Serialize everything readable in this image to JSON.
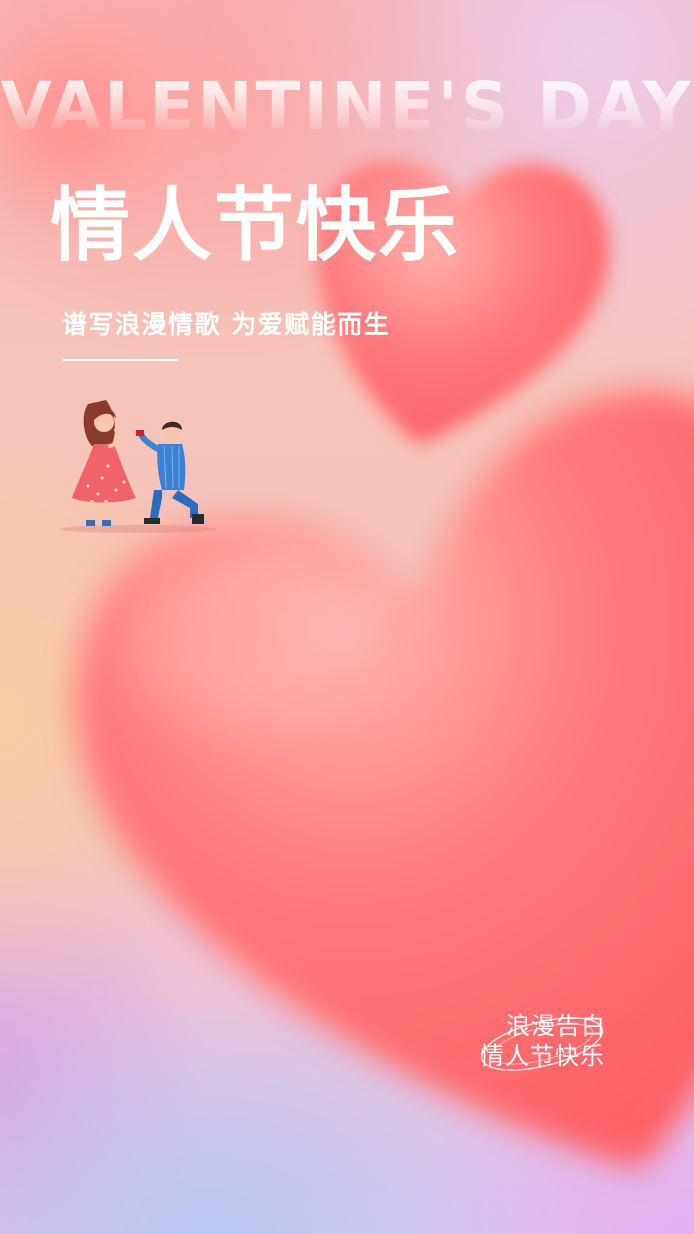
{
  "poster": {
    "background_word": "VALENTINE'S DAY",
    "title": "情人节快乐",
    "subtitle": "谱写浪漫情歌 为爱赋能而生",
    "badge": {
      "line1": "浪漫告白",
      "line2": "情人节快乐"
    }
  },
  "colors": {
    "heart": "#ff6b6e",
    "heart_highlight": "#ffb3b0",
    "text": "#ffffff",
    "bg_top": "#f6b4b4",
    "bg_bottom": "#dcc7ee"
  },
  "illustration": {
    "icon": "proposing-couple-illustration"
  }
}
